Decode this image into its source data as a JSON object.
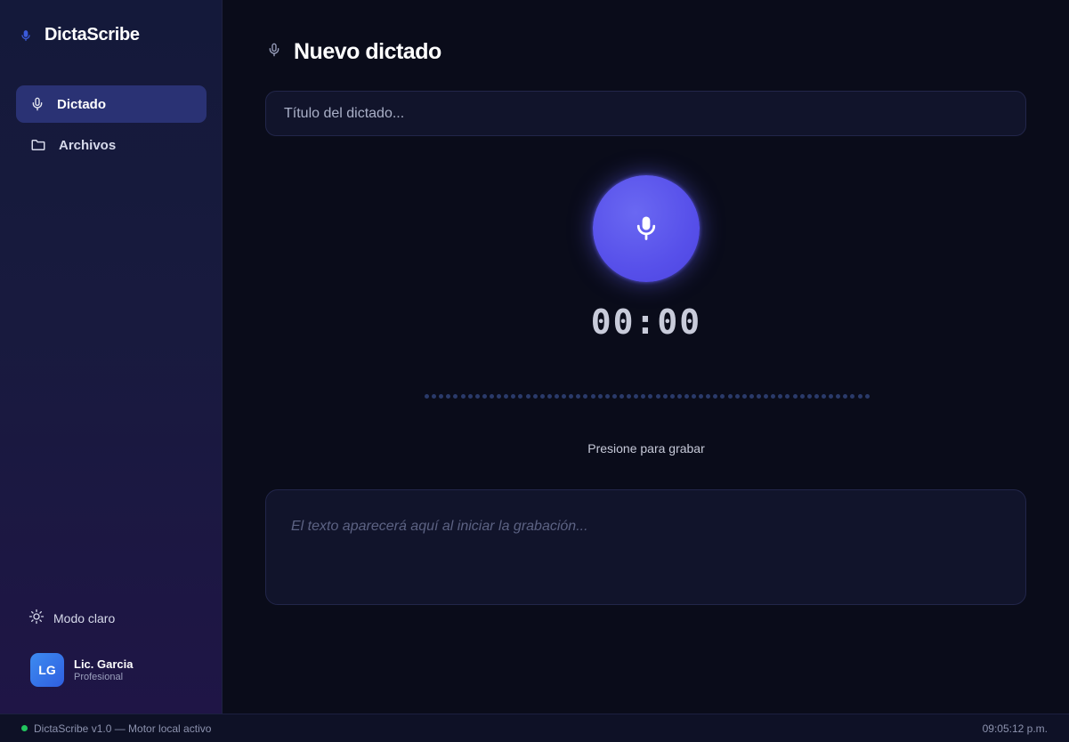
{
  "app": {
    "name": "DictaScribe"
  },
  "sidebar": {
    "items": [
      {
        "label": "Dictado",
        "icon": "mic-icon",
        "active": true
      },
      {
        "label": "Archivos",
        "icon": "folder-icon",
        "active": false
      }
    ],
    "theme_toggle_label": "Modo claro",
    "user": {
      "initials": "LG",
      "name": "Lic. Garcia",
      "role": "Profesional"
    }
  },
  "main": {
    "title": "Nuevo dictado",
    "title_input_placeholder": "Título del dictado...",
    "title_input_value": "",
    "timer": "00:00",
    "record_hint": "Presione para grabar",
    "transcript_placeholder": "El texto aparecerá aquí al iniciar la grabación..."
  },
  "statusbar": {
    "left_text": "DictaScribe v1.0 — Motor local activo",
    "time": "09:05:12 p.m."
  },
  "colors": {
    "accent": "#5b55ec",
    "active_nav": "#2a3274",
    "status_ok": "#22c55e",
    "brand_icon": "#3b5bdb"
  }
}
